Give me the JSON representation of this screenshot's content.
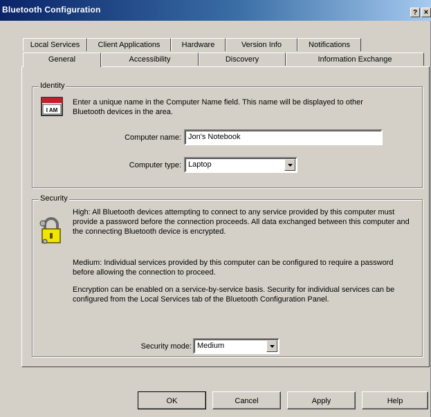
{
  "window": {
    "title": "Bluetooth Configuration",
    "help_glyph": "?",
    "close_glyph": "×"
  },
  "tabs": {
    "row1": [
      "Local Services",
      "Client Applications",
      "Hardware",
      "Version Info",
      "Notifications"
    ],
    "row2": [
      "General",
      "Accessibility",
      "Discovery",
      "Information Exchange"
    ],
    "active": "General"
  },
  "identity": {
    "legend": "Identity",
    "description": "Enter a unique name in the Computer Name field. This name will be displayed to other Bluetooth devices in the area.",
    "icon": "computer-card-icon",
    "icon_text": "I AM",
    "computer_name_label": "Computer name:",
    "computer_name_value": "Jon's Notebook",
    "computer_type_label": "Computer type:",
    "computer_type_value": "Laptop"
  },
  "security": {
    "legend": "Security",
    "icon": "padlock-icon",
    "high_text": "High: All Bluetooth devices attempting to connect to any service provided by this computer must provide a password before the connection proceeds. All data exchanged between this computer and the connecting Bluetooth device is encrypted.",
    "medium_text": "Medium: Individual services provided by this computer can be configured to require a password before allowing the connection to proceed.",
    "encryption_text": "Encryption can be enabled on a service-by-service basis. Security for individual services can be configured from the Local Services tab of the Bluetooth Configuration Panel.",
    "mode_label": "Security mode:",
    "mode_value": "Medium"
  },
  "buttons": {
    "ok": "OK",
    "cancel": "Cancel",
    "apply": "Apply",
    "help": "Help"
  },
  "colors": {
    "titlebar_start": "#0a246a",
    "titlebar_end": "#a6caf0",
    "face": "#d4d0c8",
    "lock_yellow": "#f2e600"
  }
}
